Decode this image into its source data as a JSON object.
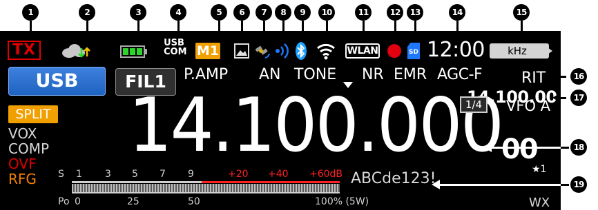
{
  "callouts": [
    "1",
    "2",
    "3",
    "4",
    "5",
    "6",
    "7",
    "8",
    "9",
    "10",
    "11",
    "12",
    "13",
    "14",
    "15",
    "16",
    "17",
    "18",
    "19"
  ],
  "status_bar": {
    "tx": "TX",
    "usb_com_top": "USB",
    "usb_com_bottom": "COM",
    "memory": "M1",
    "wlan": "WLAN",
    "sd": "SD",
    "clock": "12:00",
    "unit": "kHz"
  },
  "mode_row": {
    "mode": "USB",
    "filter": "FIL1",
    "p_amp": "P.AMP",
    "an": "AN",
    "tone": "TONE",
    "nr": "NR",
    "emr": "EMR",
    "agc": "AGC-F",
    "rit": "RIT"
  },
  "left_indicators": {
    "split": "SPLIT",
    "vox": "VOX",
    "comp": "COMP",
    "ovf": "OVF",
    "rfg": "RFG"
  },
  "frequency": {
    "main": "14.100.000",
    "sub": "14.100.00",
    "step": "1/4",
    "vfo": "VFO A",
    "small_digits": "00",
    "memory_star": "★1"
  },
  "meter": {
    "s_label": "S",
    "s_ticks": [
      "1",
      "3",
      "5",
      "7",
      "9"
    ],
    "db_ticks": [
      "+20",
      "+40",
      "+60dB"
    ],
    "po_label": "Po",
    "po_ticks": [
      "0",
      "25",
      "50",
      "100% (5W)"
    ],
    "s_level_fraction": 0
  },
  "message": "ABCde123!",
  "wx": "WX",
  "colors": {
    "tx_red": "#e00000",
    "mode_blue": "#1f63c2",
    "memory_orange": "#f0a000",
    "split_orange": "#f0a000",
    "ovf_red": "#e00000",
    "rfg_orange": "#f08000",
    "meter_red": "#ff2020",
    "bluetooth": "#1ea0ff"
  }
}
